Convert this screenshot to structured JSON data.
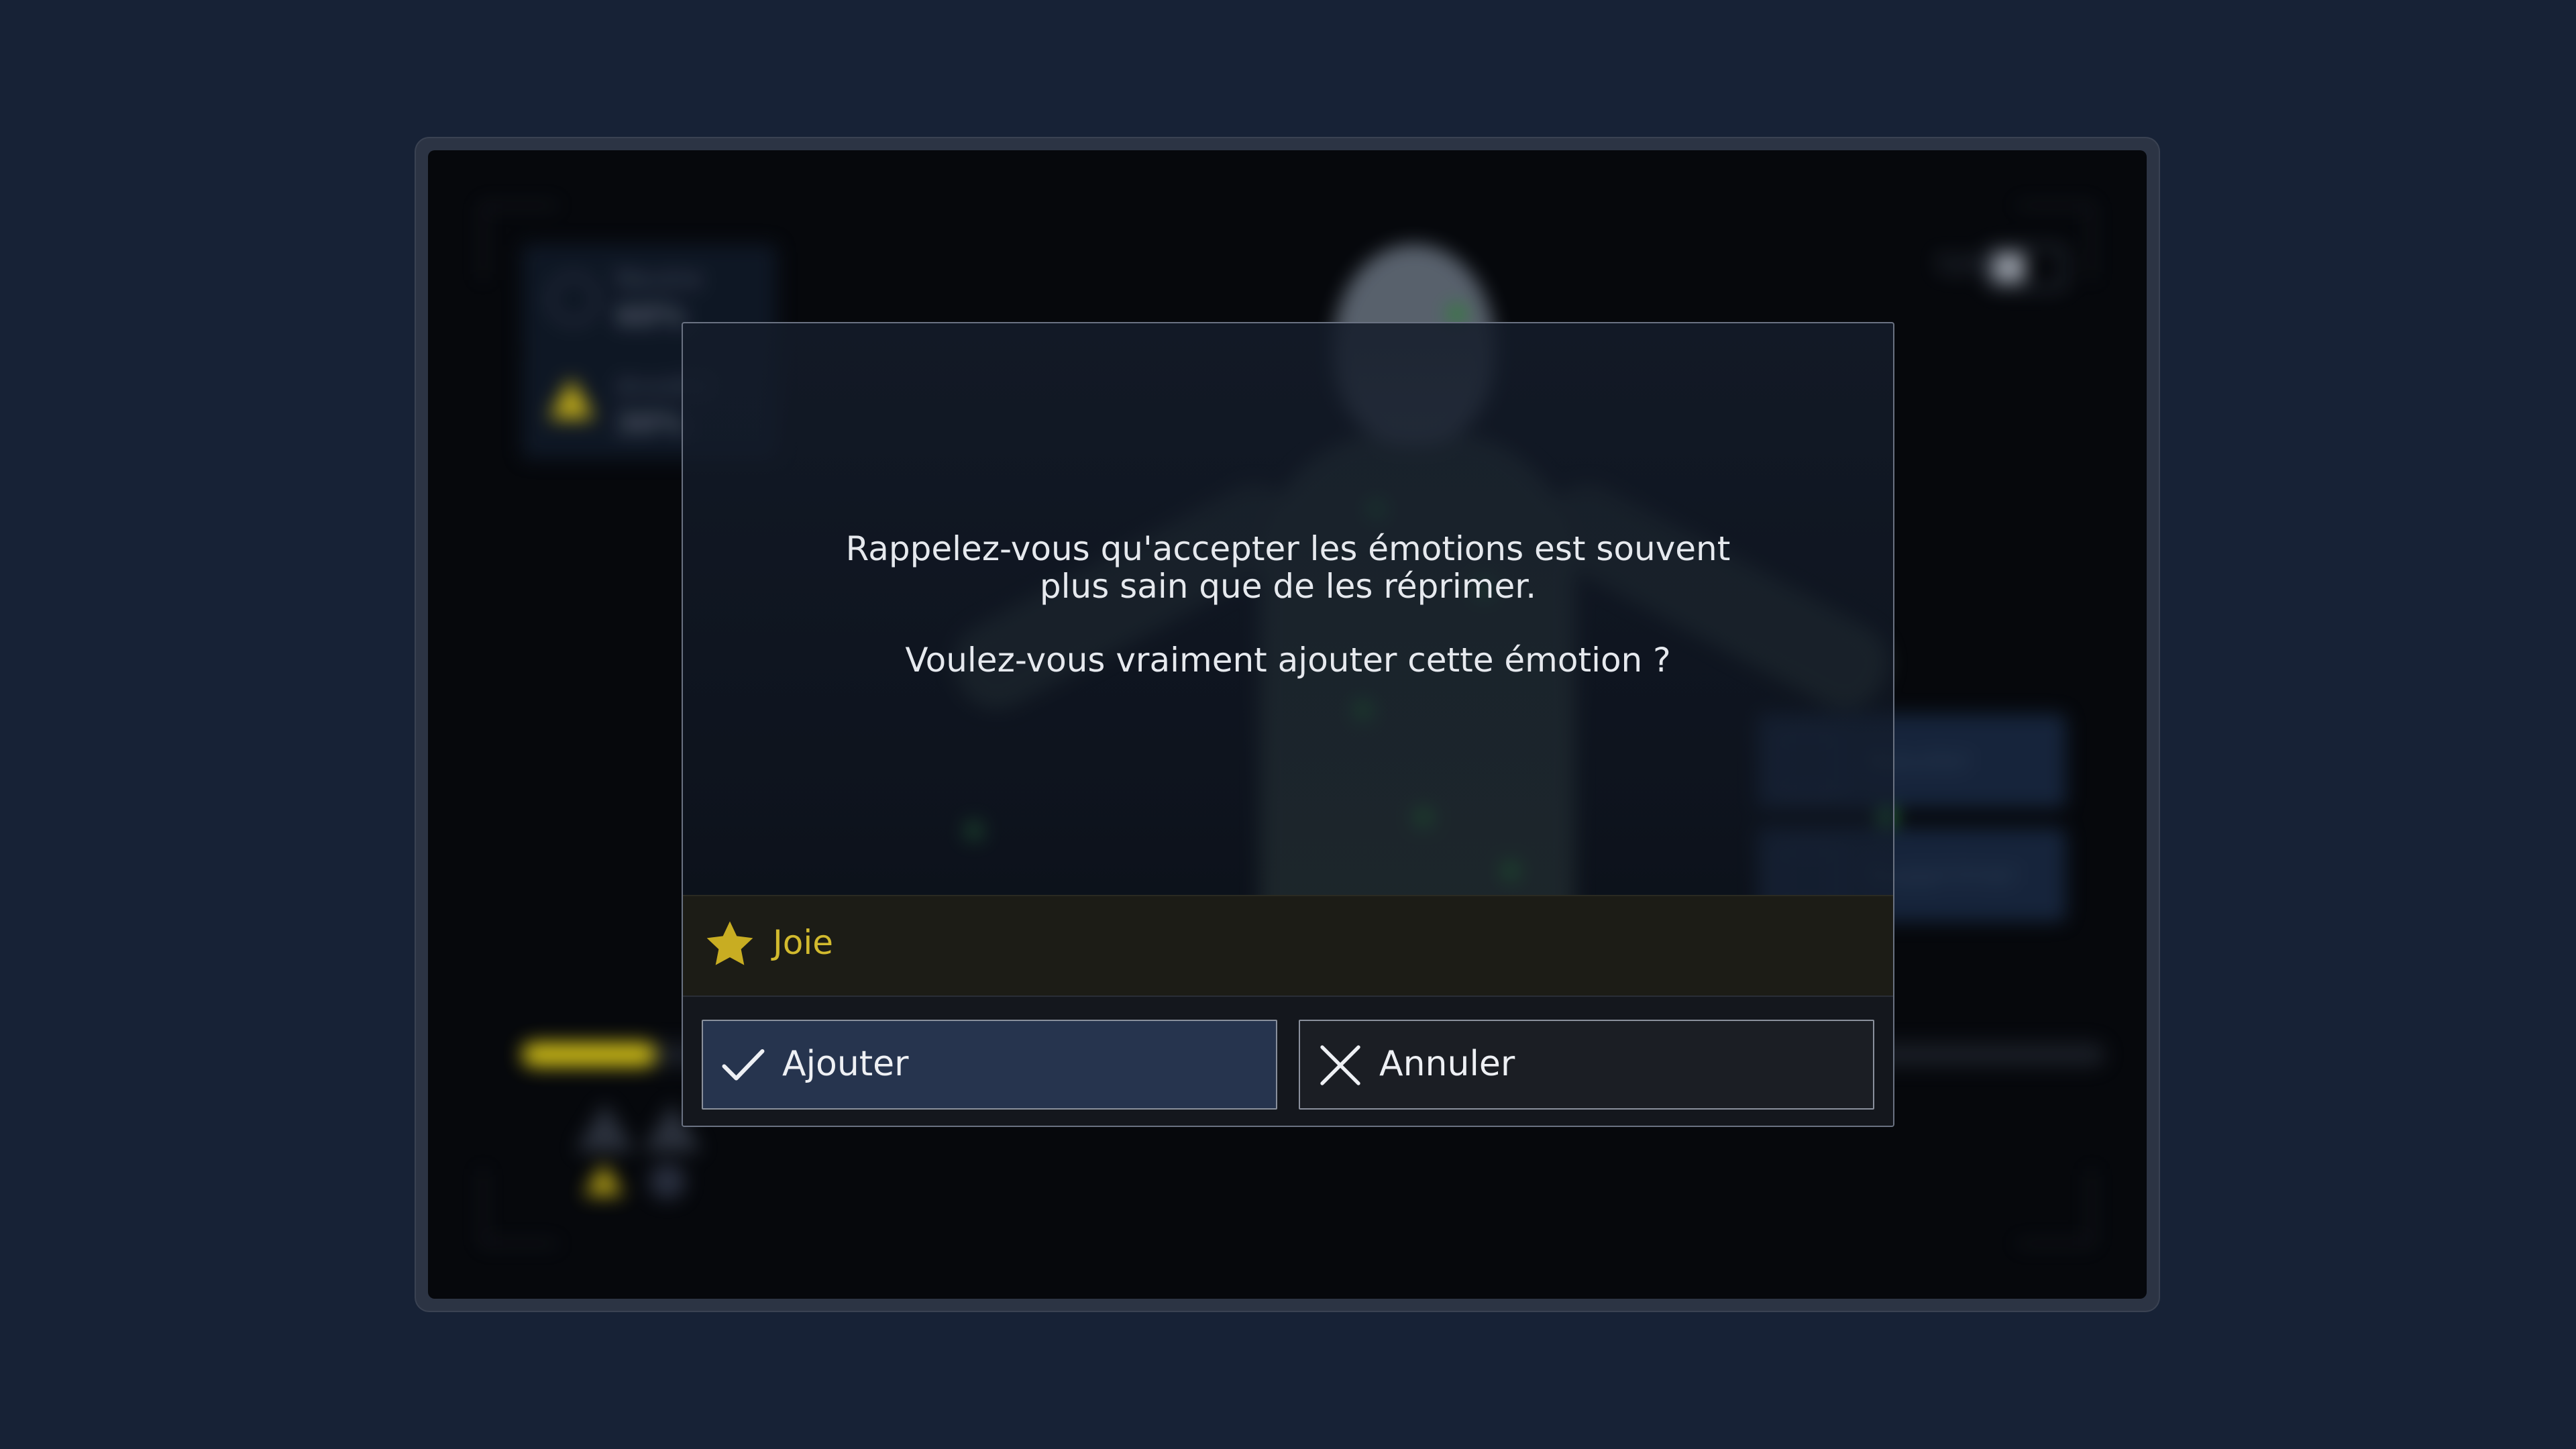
{
  "background": {
    "stats": [
      {
        "label": "Neutre",
        "value": "60%"
      },
      {
        "label": "Anxiété",
        "value": "30%"
      }
    ],
    "battery_pct": "72%",
    "side_buttons": [
      "Ajouter",
      "Supprimer"
    ]
  },
  "dialog": {
    "message": "Rappelez-vous qu'accepter les émotions est souvent plus sain que de les réprimer.",
    "question": "Voulez-vous vraiment ajouter cette émotion ?",
    "emotion": {
      "label": "Joie",
      "icon": "star-icon",
      "color": "#d2ba2e"
    },
    "confirm": {
      "label": "Ajouter",
      "icon": "check-icon"
    },
    "cancel": {
      "label": "Annuler",
      "icon": "close-icon"
    }
  },
  "colors": {
    "page_bg": "#172236",
    "accent_yellow": "#d2ba2e",
    "confirm_bg": "#26344e",
    "cancel_bg": "#1b1e24"
  }
}
